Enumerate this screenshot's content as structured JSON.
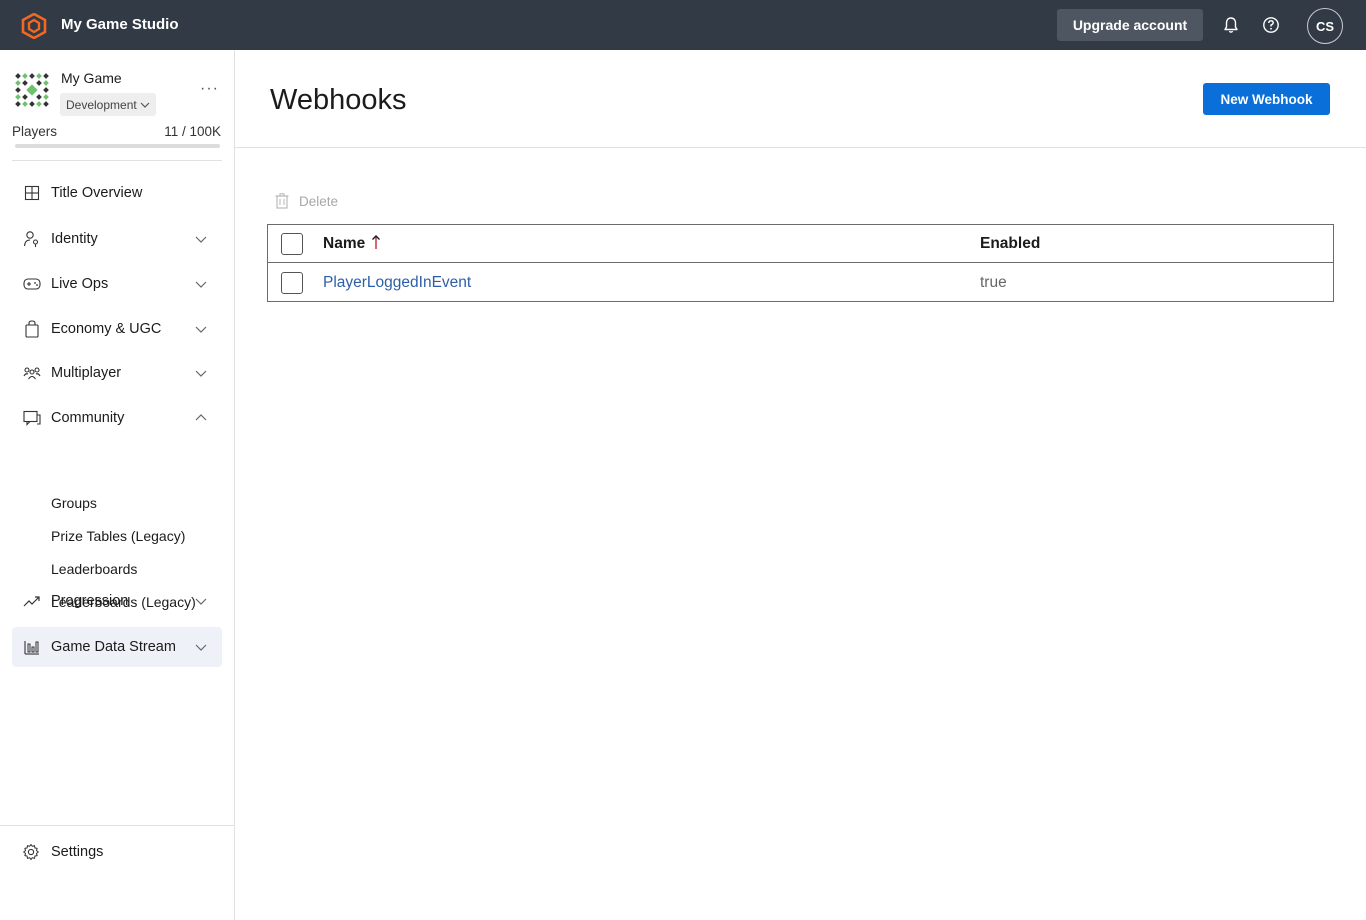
{
  "topbar": {
    "studio_name": "My Game Studio",
    "upgrade_label": "Upgrade account",
    "avatar_initials": "CS",
    "brand_color": "#f26722",
    "bar_color": "#323a45"
  },
  "sidebar": {
    "game_name": "My Game",
    "environment": "Development",
    "players_label": "Players",
    "players_count": "11 / 100K",
    "players_fraction": 0.00011,
    "nav": [
      {
        "label": "Title Overview",
        "icon": "grid-icon",
        "expandable": false
      },
      {
        "label": "Identity",
        "icon": "person-key-icon",
        "expandable": true
      },
      {
        "label": "Live Ops",
        "icon": "gamepad-icon",
        "expandable": true
      },
      {
        "label": "Economy & UGC",
        "icon": "shopping-bag-icon",
        "expandable": true
      },
      {
        "label": "Multiplayer",
        "icon": "people-icon",
        "expandable": true
      },
      {
        "label": "Community",
        "icon": "chat-icon",
        "expandable": true,
        "expanded": true
      },
      {
        "label": "Progression",
        "icon": "trend-icon",
        "expandable": true
      },
      {
        "label": "Game Data Stream",
        "icon": "bar-chart-icon",
        "expandable": true,
        "active": true
      }
    ],
    "community_sub": [
      "Groups",
      "Prize Tables (Legacy)",
      "Leaderboards",
      "Leaderboards (Legacy)"
    ],
    "settings_label": "Settings"
  },
  "main": {
    "title": "Webhooks",
    "new_button": "New Webhook",
    "delete_label": "Delete",
    "table": {
      "columns": [
        "Name",
        "Enabled"
      ],
      "rows": [
        {
          "name": "PlayerLoggedInEvent",
          "enabled": "true"
        }
      ]
    },
    "primary_color": "#0a6fd8",
    "link_color": "#2f5ea8"
  }
}
